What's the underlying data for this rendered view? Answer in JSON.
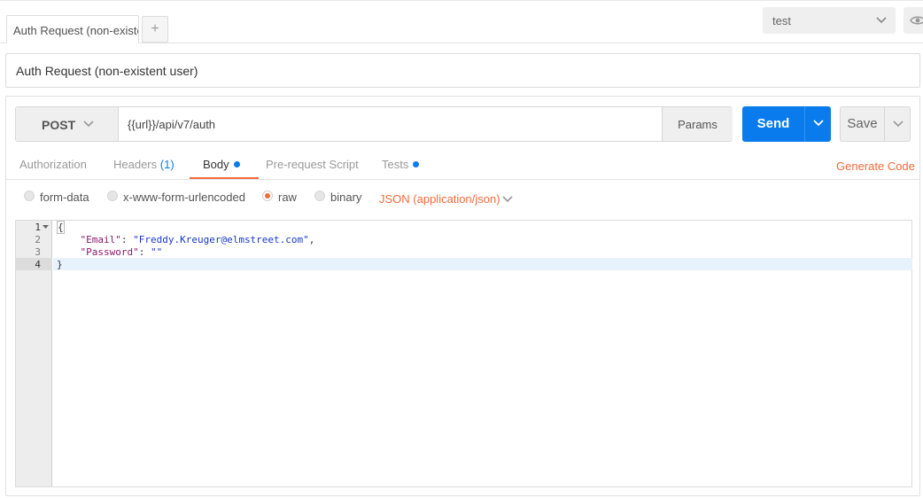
{
  "tab_bar": {
    "active_tab": "Auth Request (non-existe",
    "add_tab": "+",
    "environment": "test"
  },
  "request": {
    "name": "Auth Request (non-existent user)",
    "method": "POST",
    "url": "{{url}}/api/v7/auth",
    "params_label": "Params",
    "send_label": "Send",
    "save_label": "Save"
  },
  "sub_tabs": {
    "authorization": "Authorization",
    "headers": "Headers",
    "headers_count": "(1)",
    "body": "Body",
    "pre_request": "Pre-request Script",
    "tests": "Tests",
    "generate_code": "Generate Code"
  },
  "body_modes": {
    "form_data": "form-data",
    "urlencoded": "x-www-form-urlencoded",
    "raw": "raw",
    "binary": "binary",
    "content_type": "JSON (application/json)",
    "selected": "raw"
  },
  "editor": {
    "line_numbers": [
      "1",
      "2",
      "3",
      "4"
    ],
    "line1": "{",
    "line2_key": "\"Email\"",
    "line2_sep": ": ",
    "line2_val": "\"Freddy.Kreuger@elmstreet.com\"",
    "line2_end": ",",
    "line3_key": "\"Password\"",
    "line3_sep": ": ",
    "line3_val": "\"\"",
    "line4": "}"
  },
  "colors": {
    "accent_blue": "#097bed",
    "accent_orange": "#f26b3a"
  },
  "icons": [
    "chevron-down-icon",
    "eye-icon",
    "plus-icon",
    "fold-arrow-icon"
  ]
}
